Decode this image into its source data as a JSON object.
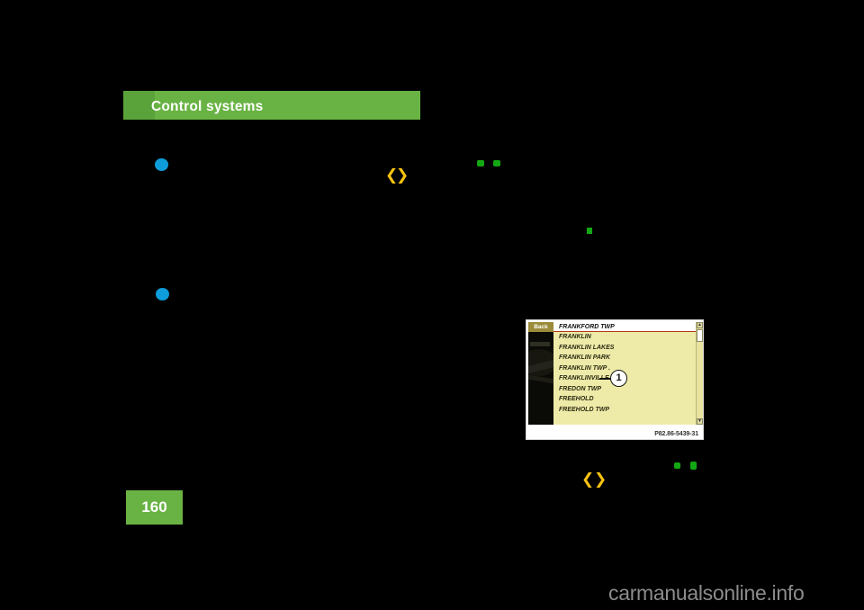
{
  "page": {
    "number": "160",
    "watermark": "carmanualsonline.info"
  },
  "chapter_header": {
    "title": "Control systems",
    "color": "#69b344"
  },
  "markers": {
    "blue_bullet_color": "#0d9ddb",
    "green_mark_color": "#13a813",
    "yellow_symbol_color": "#f5c211",
    "yellow_symbol_left": "❮",
    "yellow_symbol_right": "❯"
  },
  "figure": {
    "caption": "P82.86-5439-31",
    "callout": "1",
    "screen": {
      "back_button": "Back",
      "header_item": "FRANKFORD TWP",
      "list_items": [
        "FRANKLIN",
        "FRANKLIN LAKES",
        "FRANKLIN PARK",
        "FRANKLIN TWP .",
        "FRANKLINVILLE",
        "FREDON TWP",
        "FREEHOLD",
        "FREEHOLD TWP"
      ],
      "scroll_up": "▲",
      "scroll_down": "▼"
    }
  }
}
